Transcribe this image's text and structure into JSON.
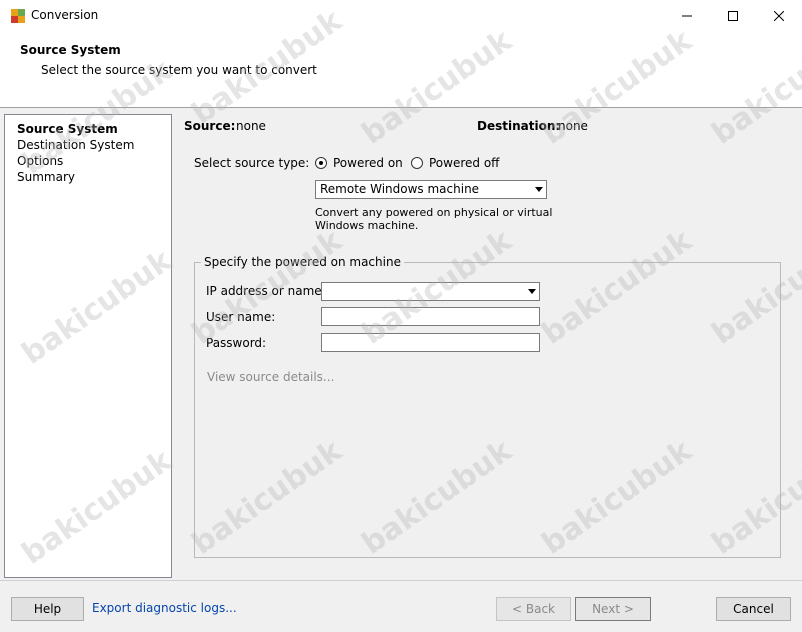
{
  "window": {
    "title": "Conversion"
  },
  "header": {
    "title": "Source System",
    "subtitle": "Select the source system you want to convert"
  },
  "nav": {
    "items": [
      {
        "label": "Source System",
        "active": true
      },
      {
        "label": "Destination System",
        "active": false
      },
      {
        "label": "Options",
        "active": false
      },
      {
        "label": "Summary",
        "active": false
      }
    ]
  },
  "summary": {
    "source_label": "Source:",
    "source_value": "none",
    "destination_label": "Destination:",
    "destination_value": "none"
  },
  "source_type": {
    "label": "Select source type:",
    "powered_on": "Powered on",
    "powered_off": "Powered off",
    "selected": "Powered on",
    "machine_type": "Remote Windows machine",
    "description_line1": "Convert any powered on physical or virtual",
    "description_line2": "Windows machine."
  },
  "group": {
    "title": "Specify the powered on machine",
    "ip_label": "IP address or name:",
    "ip_value": "",
    "user_label": "User name:",
    "user_value": "",
    "password_label": "Password:",
    "password_value": "",
    "view_details": "View source details..."
  },
  "footer": {
    "help": "Help",
    "export_logs": "Export diagnostic logs...",
    "back": "< Back",
    "next": "Next >",
    "cancel": "Cancel"
  },
  "watermark": "bakicubuk"
}
